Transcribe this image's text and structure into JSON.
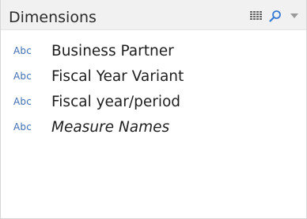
{
  "panel": {
    "title": "Dimensions",
    "tools": [
      {
        "icon": "grid-view-icon"
      },
      {
        "icon": "search-icon"
      },
      {
        "icon": "dropdown-arrow-icon"
      }
    ]
  },
  "fields": [
    {
      "type": "Abc",
      "label": "Business Partner",
      "italic": false
    },
    {
      "type": "Abc",
      "label": "Fiscal Year Variant",
      "italic": false
    },
    {
      "type": "Abc",
      "label": "Fiscal year/period",
      "italic": false
    },
    {
      "type": "Abc",
      "label": "Measure Names",
      "italic": true
    }
  ],
  "colors": {
    "header_bg": "#f1f1f1",
    "type_badge": "#3f6fb3",
    "search_icon": "#3a7bd5",
    "grid_icon": "#6a6a6a",
    "dropdown_icon": "#9a9a9a"
  }
}
